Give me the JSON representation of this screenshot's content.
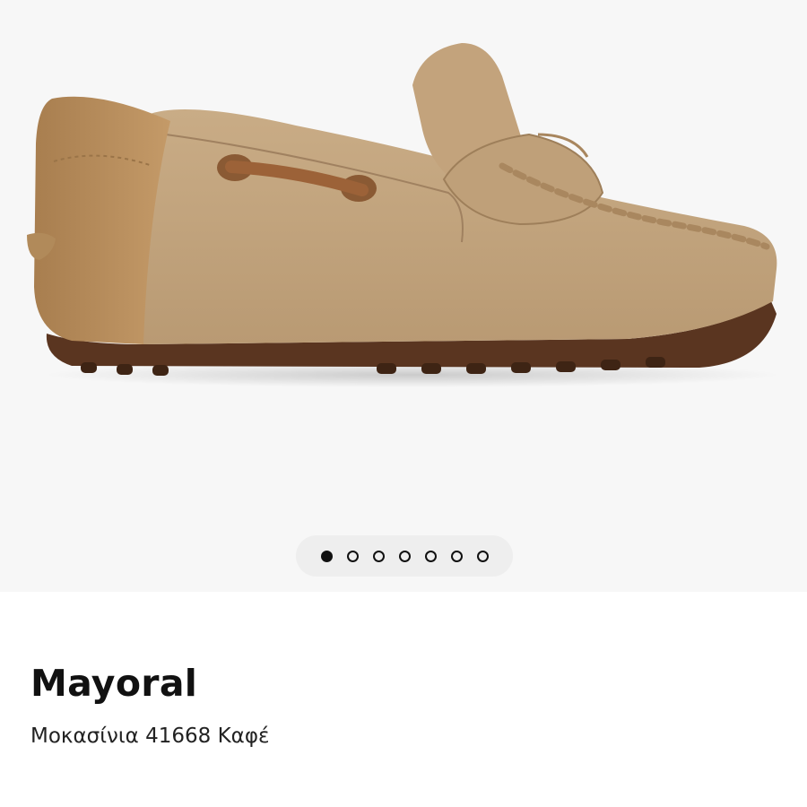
{
  "product": {
    "brand": "Mayoral",
    "name": "Μοκασίνια 41668 Καφέ"
  },
  "gallery": {
    "image_alt": "Mayoral Μοκασίνια 41668 Καφέ",
    "image_count": 7,
    "active_index": 0,
    "dots": [
      {
        "label": "1",
        "active": true
      },
      {
        "label": "2",
        "active": false
      },
      {
        "label": "3",
        "active": false
      },
      {
        "label": "4",
        "active": false
      },
      {
        "label": "5",
        "active": false
      },
      {
        "label": "6",
        "active": false
      },
      {
        "label": "7",
        "active": false
      }
    ]
  },
  "colors": {
    "gallery_background": "#f7f7f7",
    "suede": "#c1a27c",
    "leather_heel": "#b8905f",
    "sole": "#5a3520",
    "lace": "#9c6238",
    "dot_active": "#111111"
  }
}
